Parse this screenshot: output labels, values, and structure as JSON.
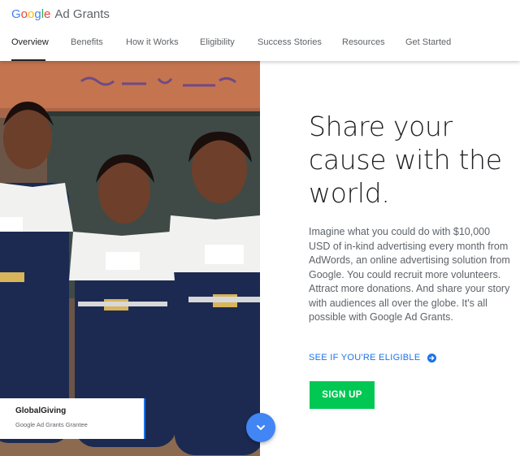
{
  "brand": {
    "google_letters": [
      {
        "char": "G",
        "color": "#4285f4"
      },
      {
        "char": "o",
        "color": "#ea4335"
      },
      {
        "char": "o",
        "color": "#fbbc05"
      },
      {
        "char": "g",
        "color": "#4285f4"
      },
      {
        "char": "l",
        "color": "#34a853"
      },
      {
        "char": "e",
        "color": "#ea4335"
      }
    ],
    "product": "Ad Grants"
  },
  "nav": {
    "items": [
      {
        "label": "Overview",
        "active": true
      },
      {
        "label": "Benefits",
        "active": false
      },
      {
        "label": "How it Works",
        "active": false
      },
      {
        "label": "Eligibility",
        "active": false
      },
      {
        "label": "Success Stories",
        "active": false
      },
      {
        "label": "Resources",
        "active": false
      },
      {
        "label": "Get Started",
        "active": false
      }
    ]
  },
  "hero": {
    "title": "Share your cause with the world.",
    "body": "Imagine what you could do with $10,000 USD of in-kind advertising every month from AdWords, an online advertising solution from Google. You could recruit more volunteers. Attract more donations. And share your story with audiences all over the globe. It's all possible with Google Ad Grants.",
    "eligible_link": "SEE IF YOU'RE ELIGIBLE",
    "signup_label": "SIGN UP"
  },
  "caption": {
    "title": "GlobalGiving",
    "subtitle": "Google Ad Grants Grantee"
  },
  "colors": {
    "link_blue": "#1a73e8",
    "signup_green": "#00c853",
    "scroll_button_blue": "#4285f4"
  },
  "icons": {
    "eligible_arrow": "arrow-circle-right-icon",
    "scroll": "chevron-down-icon"
  }
}
